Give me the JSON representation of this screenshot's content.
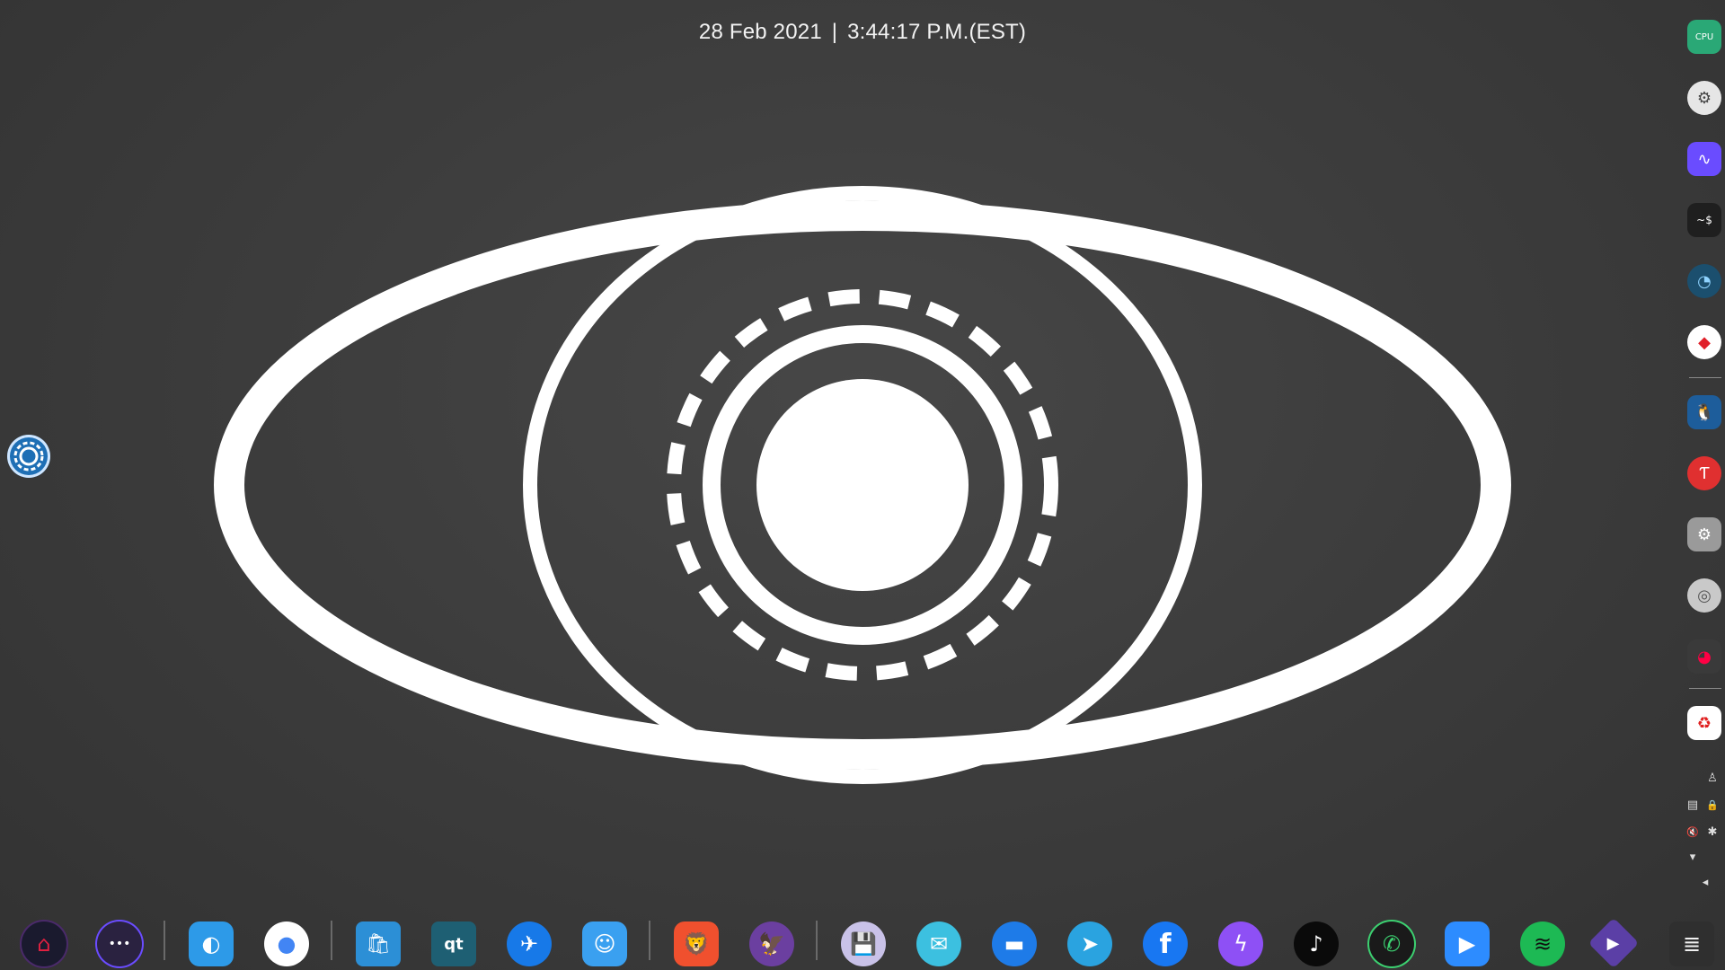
{
  "clock": {
    "date": "28 Feb 2021",
    "separator": "|",
    "time": "3:44:17 P.M.(EST)"
  },
  "right_dock": {
    "items": [
      {
        "name": "cpu-monitor",
        "glyph": "CPU",
        "color": "#2aa876"
      },
      {
        "name": "system-settings",
        "glyph": "⚙",
        "color": "#e6e6e6"
      },
      {
        "name": "audio-waves",
        "glyph": "∿",
        "color": "#6a4cff"
      },
      {
        "name": "terminal",
        "glyph": "~$",
        "color": "#1f1f1f"
      },
      {
        "name": "speed-gauge",
        "glyph": "◔",
        "color": "#1b4f6e"
      },
      {
        "name": "red-diamond",
        "glyph": "◆",
        "color": "#ffffff"
      },
      {
        "name": "linux-penguin",
        "glyph": "🐧",
        "color": "#1d5d9b"
      },
      {
        "name": "red-t-app",
        "glyph": "Ƭ",
        "color": "#e03030"
      },
      {
        "name": "gear-settings",
        "glyph": "⚙",
        "color": "#9a9a9a"
      },
      {
        "name": "disk-utility",
        "glyph": "◎",
        "color": "#c9c9c9"
      },
      {
        "name": "color-picker",
        "glyph": "◕",
        "color": "#3a3a3a"
      },
      {
        "name": "trash",
        "glyph": "♻",
        "color": "#ffffff"
      }
    ]
  },
  "tray": {
    "user": "♙",
    "clipboard": "▤",
    "lock": "🔒",
    "volume": "🔇",
    "bluetooth": "✱",
    "wifi": "▾",
    "collapse": "◂"
  },
  "bottom_dock": {
    "items": [
      {
        "name": "home-launcher",
        "glyph": "⌂",
        "bg": "#1a1a2e"
      },
      {
        "name": "more-apps",
        "glyph": "•••",
        "bg": "#2a2240"
      },
      {
        "name": "adjust-app",
        "glyph": "◐",
        "bg": "#2d9ae8"
      },
      {
        "name": "google-assistant",
        "glyph": "●",
        "bg": "#ffffff"
      },
      {
        "name": "app-store",
        "glyph": "🛍",
        "bg": "#2c8fd6"
      },
      {
        "name": "qt-app",
        "glyph": "qt",
        "bg": "#1e5f73"
      },
      {
        "name": "telescope-app",
        "glyph": "✈",
        "bg": "#1779e8"
      },
      {
        "name": "finder",
        "glyph": "☺",
        "bg": "#3aa0f0"
      },
      {
        "name": "brave-browser",
        "glyph": "🦁",
        "bg": "#f0502e"
      },
      {
        "name": "eagle-app",
        "glyph": "🦅",
        "bg": "#6b3fa0"
      },
      {
        "name": "floppy-save",
        "glyph": "💾",
        "bg": "#c9c2e8"
      },
      {
        "name": "mail",
        "glyph": "✉",
        "bg": "#3cc0e0"
      },
      {
        "name": "messages",
        "glyph": "▬",
        "bg": "#1e7be8"
      },
      {
        "name": "telegram",
        "glyph": "➤",
        "bg": "#2aa3e0"
      },
      {
        "name": "facebook",
        "glyph": "f",
        "bg": "#1877f2"
      },
      {
        "name": "messenger",
        "glyph": "ϟ",
        "bg": "#8e50f5"
      },
      {
        "name": "tiktok",
        "glyph": "♪",
        "bg": "#0a0a0a"
      },
      {
        "name": "phone-app",
        "glyph": "✆",
        "bg": "#1a1a1a"
      },
      {
        "name": "zoom",
        "glyph": "▶",
        "bg": "#2d8cff"
      },
      {
        "name": "spotify",
        "glyph": "≋",
        "bg": "#1db954"
      },
      {
        "name": "diamond-play",
        "glyph": "▶",
        "bg": "#5b3fa6"
      },
      {
        "name": "layers-app",
        "glyph": "≣",
        "bg": "#d8d8d8"
      }
    ]
  }
}
